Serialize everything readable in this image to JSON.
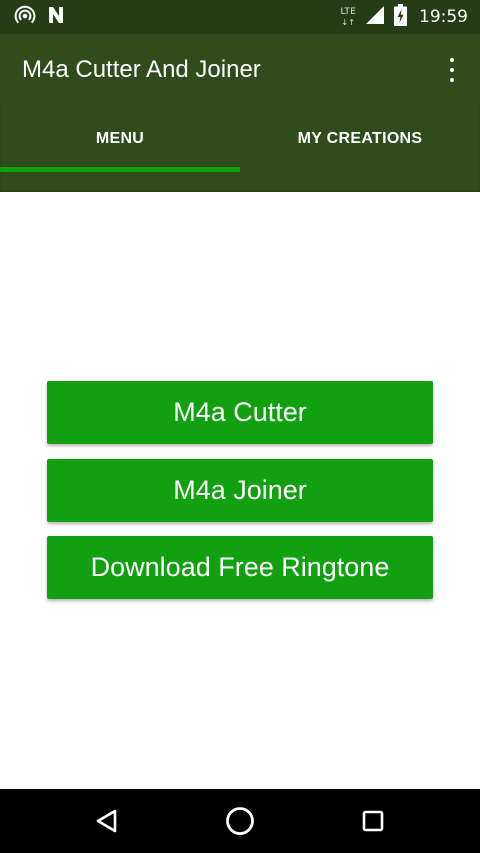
{
  "status_bar": {
    "network_type": "LTE",
    "network_arrows": "↓↑",
    "time": "19:59",
    "icons": [
      "hotspot-icon",
      "n-notification-icon",
      "signal-icon",
      "battery-charging-icon"
    ]
  },
  "app_bar": {
    "title": "M4a Cutter And Joiner",
    "menu_icon": "overflow-menu-icon"
  },
  "tabs": [
    {
      "label": "MENU",
      "selected": true
    },
    {
      "label": "MY CREATIONS",
      "selected": false
    }
  ],
  "buttons": {
    "cutter": "M4a Cutter",
    "joiner": "M4a Joiner",
    "ringtone": "Download Free Ringtone"
  },
  "nav_bar": {
    "icons": [
      "back-icon",
      "home-icon",
      "recents-icon"
    ]
  },
  "colors": {
    "status_bar": "#253d16",
    "app_bar": "#2f4c1c",
    "tab_indicator": "#0fa010",
    "button": "#10a010",
    "nav_bar": "#000000"
  }
}
